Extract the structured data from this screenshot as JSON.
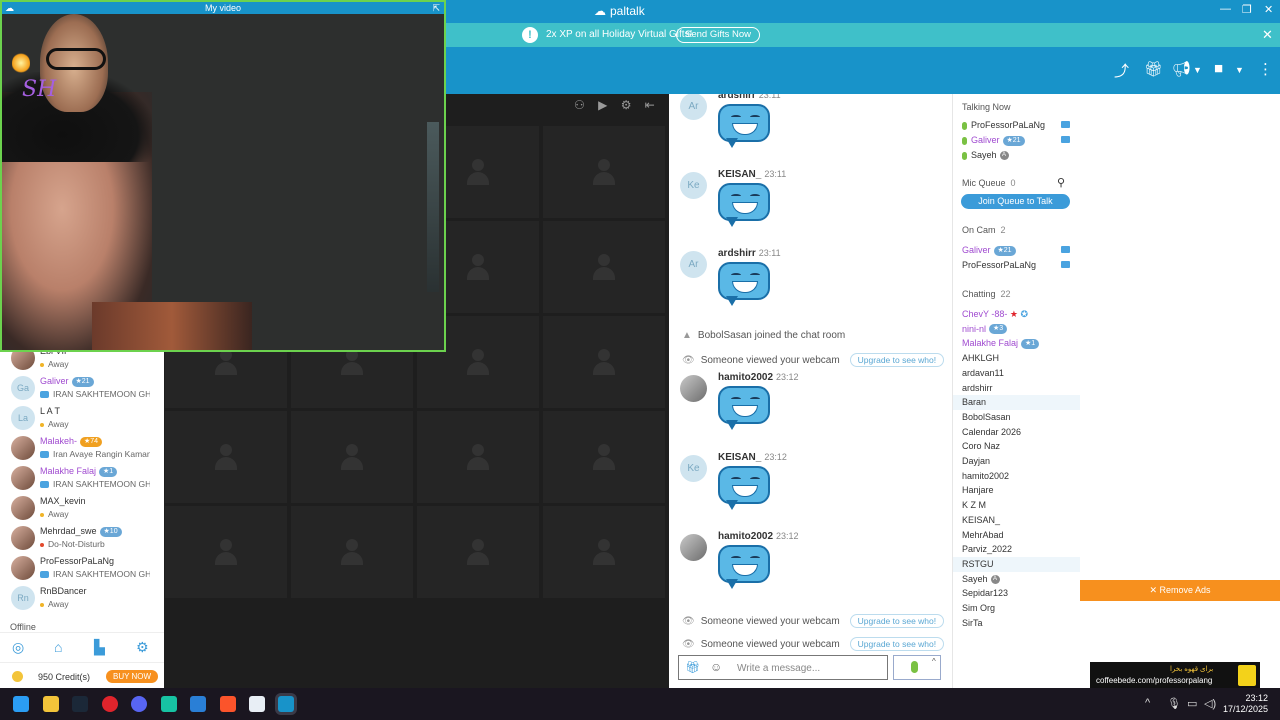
{
  "window": {
    "app_name": "paltalk",
    "video_title": "My video"
  },
  "banner": {
    "message": "2x XP on all Holiday Virtual Gifts!",
    "button": "Send Gifts Now"
  },
  "chat": {
    "messages": [
      {
        "avatar": "Ar",
        "user": "ardshirr",
        "time": "23:11",
        "type": "emoji"
      },
      {
        "avatar": "Ke",
        "user": "KEISAN_",
        "time": "23:11",
        "type": "emoji"
      },
      {
        "avatar": "Ar",
        "user": "ardshirr",
        "time": "23:11",
        "type": "emoji"
      },
      {
        "system": "BobolSasan joined the chat room"
      },
      {
        "system": "Someone viewed your webcam",
        "action": "Upgrade to see who!"
      },
      {
        "avatar": "",
        "user": "hamito2002",
        "time": "23:12",
        "type": "emoji"
      },
      {
        "avatar": "Ke",
        "user": "KEISAN_",
        "time": "23:12",
        "type": "emoji"
      },
      {
        "avatar": "",
        "user": "hamito2002",
        "time": "23:12",
        "type": "emoji"
      },
      {
        "system": "Someone viewed your webcam",
        "action": "Upgrade to see who!"
      },
      {
        "system": "Someone viewed your webcam",
        "action": "Upgrade to see who!"
      }
    ],
    "composer_placeholder": "Write a message..."
  },
  "users": {
    "talking_now_title": "Talking Now",
    "talking_now": [
      {
        "name": "ProFessorPaLaNg",
        "cam": true
      },
      {
        "name": "Galiver",
        "badge": "21",
        "cam": true,
        "purple": true
      },
      {
        "name": "Sayeh",
        "lock": "A"
      }
    ],
    "mic_queue_title": "Mic Queue",
    "mic_queue_count": "0",
    "join_queue": "Join Queue to Talk",
    "on_cam_title": "On Cam",
    "on_cam_count": "2",
    "on_cam": [
      {
        "name": "Galiver",
        "badge": "21",
        "purple": true
      },
      {
        "name": "ProFessorPaLaNg"
      }
    ],
    "chatting_title": "Chatting",
    "chatting_count": "22",
    "chatting": [
      {
        "name": "ChevY -88-",
        "purple": true
      },
      {
        "name": "nini-nl",
        "badge": "3",
        "purple": true
      },
      {
        "name": "Malakhe Falaj",
        "badge": "1",
        "purple": true
      },
      {
        "name": "AHKLGH"
      },
      {
        "name": "ardavan11"
      },
      {
        "name": "ardshirr"
      },
      {
        "name": "Baran",
        "hl": true
      },
      {
        "name": "BobolSasan"
      },
      {
        "name": "Calendar 2026"
      },
      {
        "name": "Coro Naz"
      },
      {
        "name": "Dayjan"
      },
      {
        "name": "hamito2002"
      },
      {
        "name": "Hanjare"
      },
      {
        "name": "K Z M"
      },
      {
        "name": "KEISAN_"
      },
      {
        "name": "MehrAbad"
      },
      {
        "name": "Parviz_2022"
      },
      {
        "name": "RSTGU",
        "hl": true
      },
      {
        "name": "Sayeh",
        "lock": "A"
      },
      {
        "name": "Sepidar123"
      },
      {
        "name": "Sim Org"
      },
      {
        "name": "SirTa"
      }
    ]
  },
  "left_list": [
    {
      "avatar": "",
      "name": "Ebi VIP",
      "status": "Away",
      "status_type": "away"
    },
    {
      "avatar": "Ga",
      "name": "Galiver",
      "badge": "21",
      "status": "IRAN SAKHTEMOON GHE",
      "status_type": "room",
      "purple": true
    },
    {
      "avatar": "La",
      "name": "L A T",
      "status": "Away",
      "status_type": "away"
    },
    {
      "avatar": "",
      "name": "Malakeh-",
      "badge": "74",
      "gold": true,
      "status": "Iran Avaye Rangin Kaman",
      "status_type": "room",
      "purple": true
    },
    {
      "avatar": "",
      "name": "Malakhe Falaj",
      "badge": "1",
      "status": "IRAN SAKHTEMOON GHE",
      "status_type": "room",
      "purple": true
    },
    {
      "avatar": "",
      "name": "MAX_kevin",
      "status": "Away",
      "status_type": "away"
    },
    {
      "avatar": "",
      "name": "Mehrdad_swe",
      "badge": "10",
      "status": "Do-Not-Disturb",
      "status_type": "dnd"
    },
    {
      "avatar": "",
      "name": "ProFessorPaLaNg",
      "status": "IRAN SAKHTEMOON GHE",
      "status_type": "room"
    },
    {
      "avatar": "Rn",
      "name": "RnBDancer",
      "status": "Away",
      "status_type": "away"
    }
  ],
  "offline_label": "Offline",
  "credits": {
    "text": "950 Credit(s)",
    "buy": "BUY NOW"
  },
  "ads": {
    "remove": "✕ Remove Ads",
    "line1": "برای قهوه بخرا",
    "line2": "coffeebede.com/professorpalang"
  },
  "overlay": {
    "sticker_text": "SH"
  },
  "taskbar": {
    "time": "23:12",
    "date": "17/12/2025"
  },
  "colors": {
    "brand": "#1893c9",
    "banner": "#3fc0c9",
    "accent_orange": "#f7901e",
    "cam_border": "#6cd24e"
  }
}
